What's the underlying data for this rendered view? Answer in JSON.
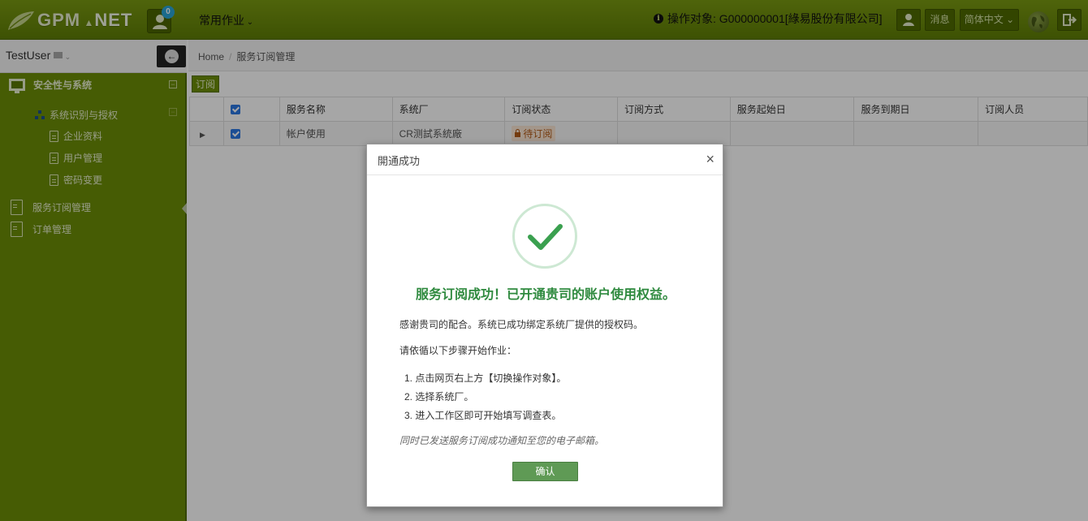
{
  "header": {
    "logo_text_a": "GPM",
    "logo_text_b": "NET",
    "badge_count": "0",
    "common_ops": "常用作业",
    "target_label": "操作对象: G000000001[綠易股份有限公司]",
    "messages_label": "消息",
    "language_label": "简体中文"
  },
  "sidebar": {
    "username": "TestUser",
    "items": [
      {
        "label": "安全性与系统"
      },
      {
        "label": "系统识别与授权"
      },
      {
        "label": "企业资料"
      },
      {
        "label": "用户管理"
      },
      {
        "label": "密码变更"
      },
      {
        "label": "服务订阅管理"
      },
      {
        "label": "订单管理"
      }
    ]
  },
  "breadcrumb": {
    "home": "Home",
    "current": "服务订阅管理"
  },
  "toolbar": {
    "subscribe_label": "订阅"
  },
  "table": {
    "columns": [
      "服务名称",
      "系统厂",
      "订阅状态",
      "订阅方式",
      "服务起始日",
      "服务到期日",
      "订阅人员"
    ],
    "rows": [
      {
        "service": "帐户使用",
        "vendor": "CR测試系統廠",
        "status": "待订阅",
        "method": "",
        "start": "",
        "end": "",
        "subscriber": ""
      }
    ]
  },
  "modal": {
    "title": "開通成功",
    "close": "×",
    "success_title": "服务订阅成功！已开通贵司的账户使用权益。",
    "thanks": "感谢贵司的配合。系统已成功绑定系统厂提供的授权码。",
    "steps_intro": "请依循以下步骤开始作业：",
    "steps": [
      "1. 点击网页右上方【切换操作对象】。",
      "2. 选择系统厂。",
      "3. 进入工作区即可开始填写调查表。"
    ],
    "note": "同时已发送服务订阅成功通知至您的电子邮箱。",
    "confirm": "确认"
  }
}
